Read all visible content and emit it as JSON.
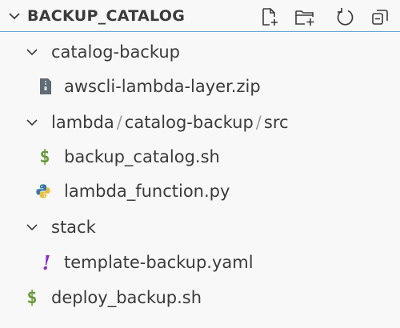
{
  "header": {
    "title": "BACKUP_CATALOG",
    "actions": [
      "new-file-icon",
      "new-folder-icon",
      "refresh-icon",
      "collapse-all-icon"
    ]
  },
  "tree": {
    "catalog_backup_folder": "catalog-backup",
    "zip_file": "awscli-lambda-layer.zip",
    "lambda_path": {
      "part1": "lambda",
      "sep1": "/",
      "part2": "catalog-backup",
      "sep2": "/",
      "part3": "src"
    },
    "sh_file": "backup_catalog.sh",
    "py_file": "lambda_function.py",
    "stack_folder": "stack",
    "yaml_file": "template-backup.yaml",
    "deploy_file": "deploy_backup.sh"
  },
  "icons": {
    "shell": "$",
    "yaml": "!"
  },
  "colors": {
    "accent": "#6a9fd6",
    "shell": "#6a9a3b",
    "yaml": "#8b2fc9",
    "python_blue": "#3b77a8",
    "python_yellow": "#e8c13a",
    "zip": "#5f6b75"
  }
}
